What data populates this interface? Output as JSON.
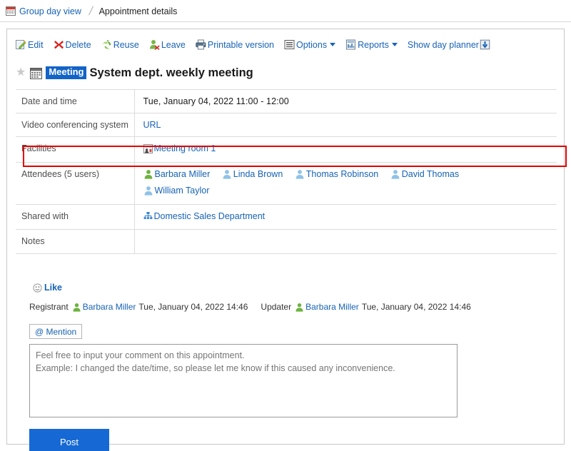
{
  "breadcrumb": {
    "icon": "calendar-icon",
    "parent": "Group day view",
    "current": "Appointment details"
  },
  "toolbar": {
    "items": [
      {
        "icon": "edit-icon",
        "label": "Edit",
        "caret": false
      },
      {
        "icon": "delete-icon",
        "label": "Delete",
        "caret": false
      },
      {
        "icon": "reuse-icon",
        "label": "Reuse",
        "caret": false
      },
      {
        "icon": "leave-icon",
        "label": "Leave",
        "caret": false
      },
      {
        "icon": "printer-icon",
        "label": "Printable version",
        "caret": false
      },
      {
        "icon": "options-icon",
        "label": "Options",
        "caret": true
      },
      {
        "icon": "reports-icon",
        "label": "Reports",
        "caret": true
      },
      {
        "icon": "download-icon",
        "label": "Show day planner",
        "caret": false
      }
    ]
  },
  "appointment": {
    "star_icon": "star-icon",
    "calendar_icon": "calendar-icon",
    "badge": "Meeting",
    "title": "System dept. weekly meeting",
    "fields": {
      "date_and_time": {
        "label": "Date and time",
        "value": "Tue, January 04, 2022   11:00  -  12:00"
      },
      "video_conferencing": {
        "label": "Video conferencing system",
        "value": "URL",
        "highlighted": true,
        "highlight_color": "#e60000"
      },
      "facilities": {
        "label": "Facilities",
        "items": [
          {
            "icon": "facility-icon",
            "name": "Meeting room 1"
          }
        ]
      },
      "attendees": {
        "label": "Attendees (5 users)",
        "items": [
          {
            "icon": "user-icon-green",
            "name": "Barbara Miller"
          },
          {
            "icon": "user-icon-blue",
            "name": "Linda Brown"
          },
          {
            "icon": "user-icon-blue",
            "name": "Thomas Robinson"
          },
          {
            "icon": "user-icon-blue",
            "name": "David Thomas"
          },
          {
            "icon": "user-icon-blue",
            "name": "William Taylor"
          }
        ]
      },
      "shared_with": {
        "label": "Shared with",
        "items": [
          {
            "icon": "org-chart-icon",
            "name": "Domestic Sales Department"
          }
        ]
      },
      "notes": {
        "label": "Notes",
        "value": ""
      }
    }
  },
  "like": {
    "icon": "smiley-icon",
    "label": "Like"
  },
  "meta": {
    "registrant_label": "Registrant",
    "registrant_icon": "user-icon-green",
    "registrant_name": "Barbara Miller",
    "registrant_time": "Tue, January 04, 2022 14:46",
    "updater_label": "Updater",
    "updater_icon": "user-icon-green",
    "updater_name": "Barbara Miller",
    "updater_time": "Tue, January 04, 2022 14:46"
  },
  "comment": {
    "mention_label": "@ Mention",
    "placeholder": "Feel free to input your comment on this appointment.\nExample: I changed the date/time, so please let me know if this caused any inconvenience.",
    "value": "",
    "post_label": "Post",
    "post_color": "#1669d4"
  }
}
